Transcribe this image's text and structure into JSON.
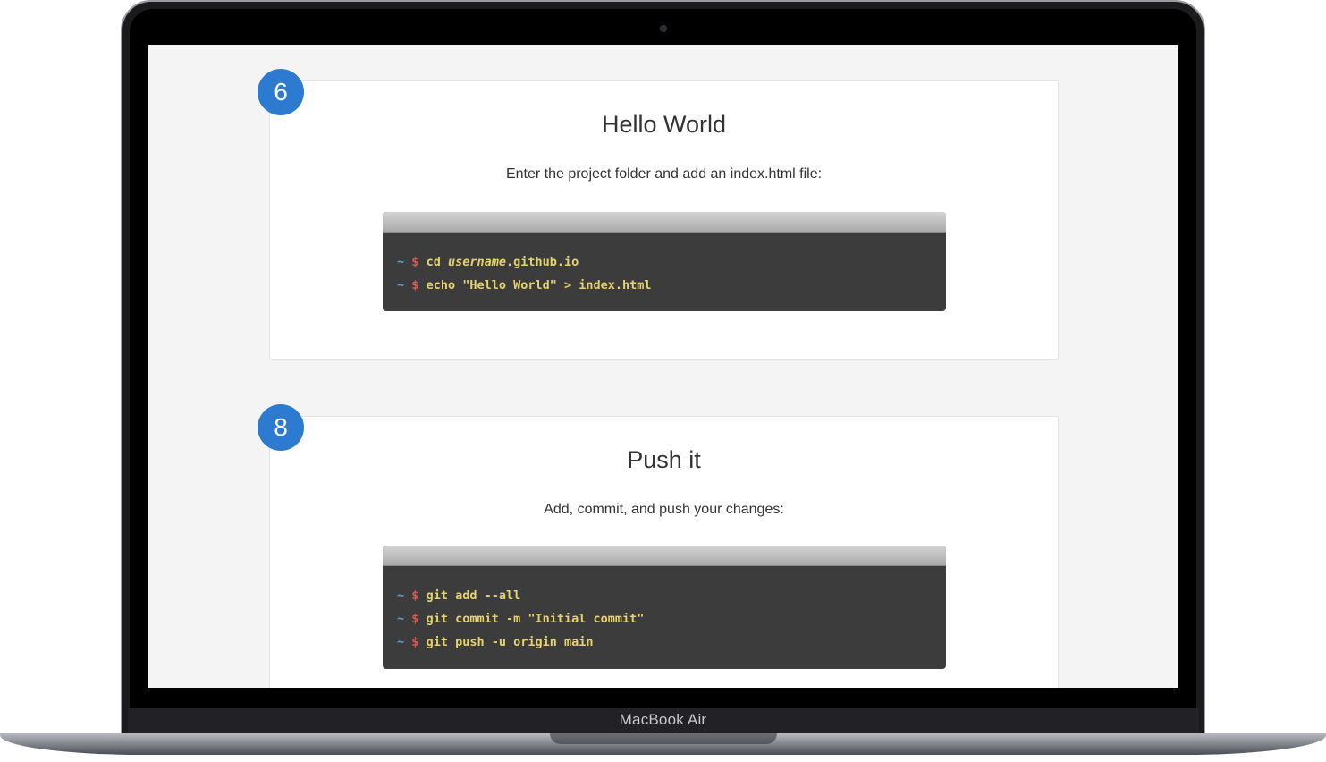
{
  "device": {
    "brand_label": "MacBook Air"
  },
  "steps": [
    {
      "number": "6",
      "title": "Hello World",
      "description": "Enter the project folder and add an index.html file:",
      "commands": [
        {
          "prompt_tilde": "~",
          "prompt_dollar": "$",
          "pre": "cd ",
          "italic": "username",
          "post": ".github.io"
        },
        {
          "prompt_tilde": "~",
          "prompt_dollar": "$",
          "pre": "echo \"Hello World\" > index.html",
          "italic": "",
          "post": ""
        }
      ]
    },
    {
      "number": "8",
      "title": "Push it",
      "description": "Add, commit, and push your changes:",
      "commands": [
        {
          "prompt_tilde": "~",
          "prompt_dollar": "$",
          "pre": "git add --all",
          "italic": "",
          "post": ""
        },
        {
          "prompt_tilde": "~",
          "prompt_dollar": "$",
          "pre": "git commit -m \"Initial commit\"",
          "italic": "",
          "post": ""
        },
        {
          "prompt_tilde": "~",
          "prompt_dollar": "$",
          "pre": "git push -u origin main",
          "italic": "",
          "post": ""
        }
      ]
    }
  ],
  "colors": {
    "badge": "#2d7bd0",
    "terminal_bg": "#3c3c3c",
    "command_text": "#e6d36a",
    "prompt_tilde": "#57a3d6",
    "prompt_dollar": "#e3554f"
  }
}
